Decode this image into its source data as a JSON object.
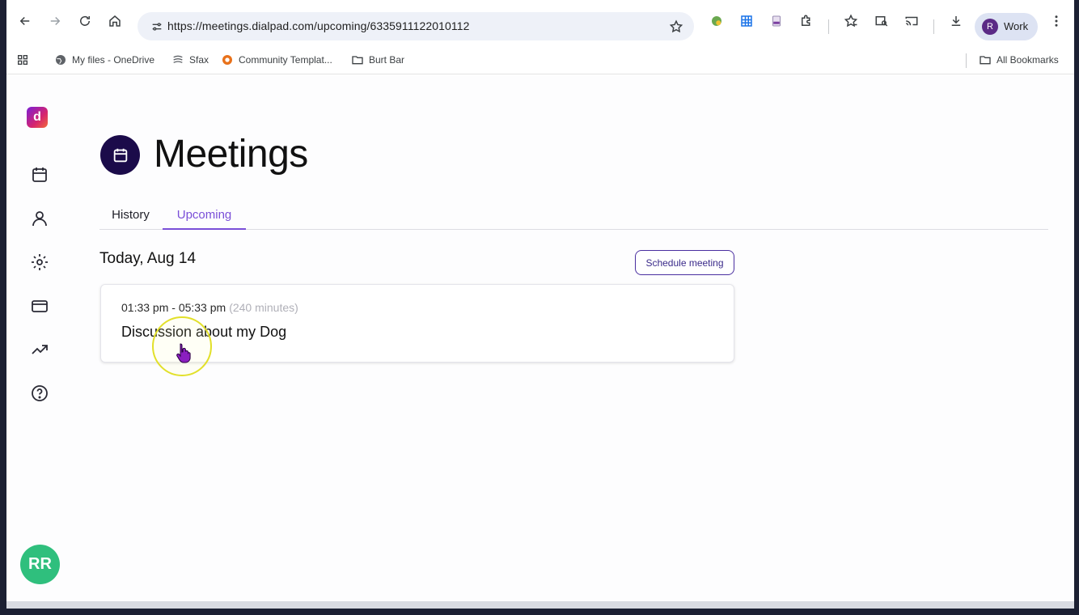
{
  "browser": {
    "url": "https://meetings.dialpad.com/upcoming/6335911122010112",
    "profile_initial": "R",
    "profile_label": "Work"
  },
  "bookmarks": [
    {
      "label": "My files - OneDrive",
      "icon": "globe-icon"
    },
    {
      "label": "Sfax",
      "icon": "sfax-icon"
    },
    {
      "label": "Community Templat...",
      "icon": "community-icon"
    },
    {
      "label": "Burt Bar",
      "icon": "folder-icon"
    }
  ],
  "all_bookmarks_label": "All Bookmarks",
  "app": {
    "logo_letter": "d",
    "user_initials": "RR",
    "page_title": "Meetings",
    "tabs": [
      {
        "label": "History",
        "active": false
      },
      {
        "label": "Upcoming",
        "active": true
      }
    ],
    "date_heading": "Today, Aug 14",
    "schedule_button": "Schedule meeting",
    "meetings": [
      {
        "time": "01:33 pm - 05:33 pm",
        "duration": "(240 minutes)",
        "title": "Discussion about my Dog"
      }
    ]
  },
  "colors": {
    "accent": "#7a4fd8",
    "title_badge": "#1b0b4a",
    "avatar": "#2fbf7d"
  }
}
